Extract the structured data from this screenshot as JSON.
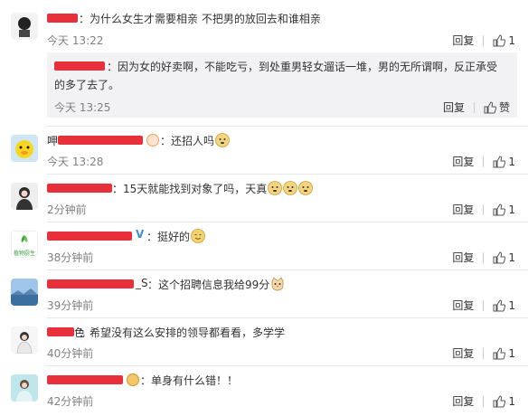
{
  "colors": {
    "redact": "#e8303a",
    "text": "#333333",
    "muted": "#808080",
    "reply_bg": "#f2f2f5"
  },
  "comments": [
    {
      "text": "为什么女生才需要相亲 不把男的放回去和谁相亲",
      "time": "今天 13:22",
      "reply": "回复",
      "like": "1",
      "sub": {
        "text1": "因为女的好卖啊，不能吃亏，到处重男轻女遛话一堆，男的无所谓啊，反正承受",
        "text2": "的多了去了。",
        "time": "今天 13:25",
        "reply": "回复",
        "like": "赞"
      }
    },
    {
      "prefix": "呷",
      "text": "还招人吗",
      "time": "今天 13:28",
      "reply": "回复",
      "like": "1"
    },
    {
      "text": "15天就能找到对象了吗，天真",
      "time": "2分钟前",
      "reply": "回复",
      "like": "1"
    },
    {
      "text": "挺好的",
      "time": "38分钟前",
      "reply": "回复",
      "like": "1",
      "avatar_text": "植物厨生"
    },
    {
      "suffix": "_S",
      "text": "这个招聘信息我给99分",
      "time": "39分钟前",
      "reply": "回复",
      "like": "1"
    },
    {
      "suffix": "色",
      "text": "希望没有这么安排的领导都看看，多学学",
      "time": "40分钟前",
      "reply": "回复",
      "like": "1"
    },
    {
      "text": "单身有什么错！！",
      "time": "42分钟前",
      "reply": "回复",
      "like": "1"
    }
  ],
  "icons": {
    "like": "thumbs-up-icon",
    "vip": "v-verified-icon",
    "emoji": "doge-emoji-icon"
  }
}
